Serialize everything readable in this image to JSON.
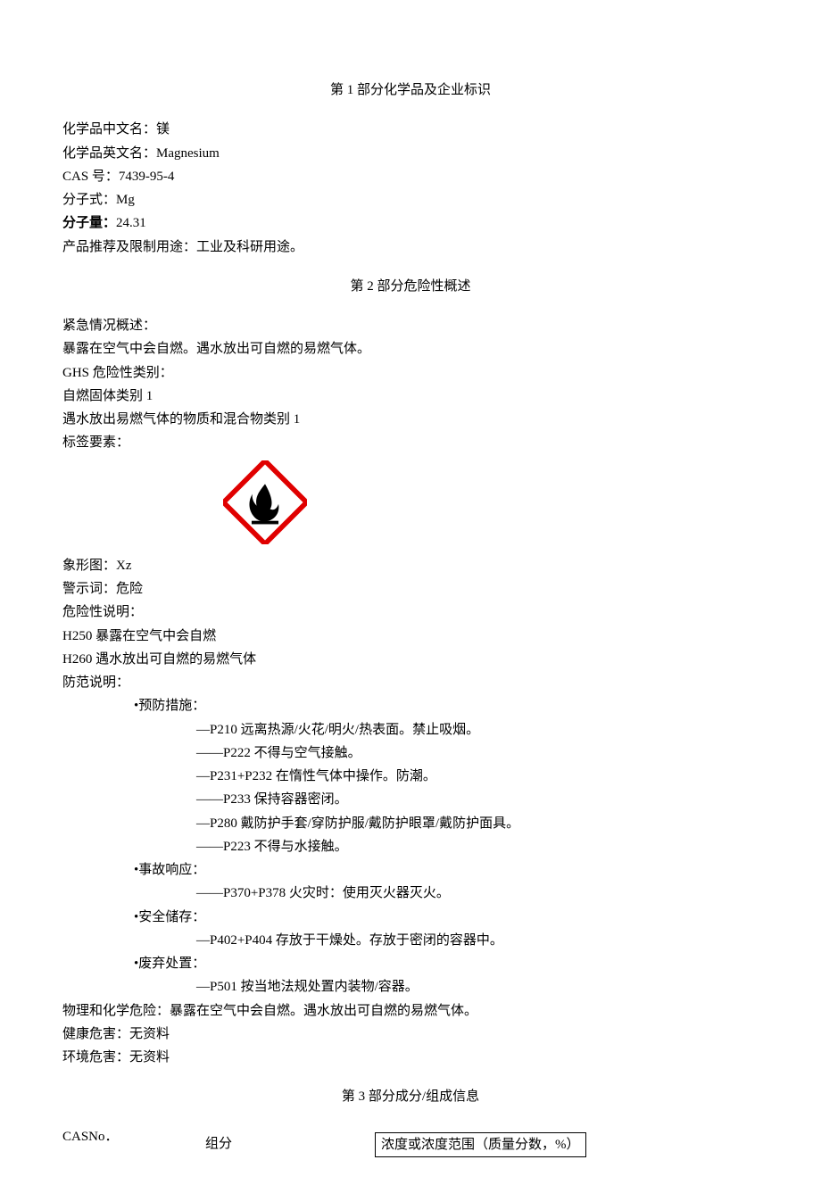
{
  "section1": {
    "title": "第 1 部分化学品及企业标识",
    "name_cn_label": "化学品中文名：镁",
    "name_en_label": "化学品英文名：Magnesium",
    "cas_label": "CAS 号：7439-95-4",
    "formula_label": "分子式：Mg",
    "mw_label_bold": "分子量：",
    "mw_value": "24.31",
    "usage_label": "产品推荐及限制用途：工业及科研用途。"
  },
  "section2": {
    "title": "第 2 部分危险性概述",
    "emergency_header": "紧急情况概述：",
    "emergency_text": "暴露在空气中会自燃。遇水放出可自燃的易燃气体。",
    "ghs_header": "GHS 危险性类别：",
    "ghs_cat1": "自燃固体类别 1",
    "ghs_cat2": "遇水放出易燃气体的物质和混合物类别 1",
    "label_elements": "标签要素：",
    "pictogram_label": "象形图：Xz",
    "pictogram_name": "GHS 火焰象形图",
    "signal_word": "警示词：危险",
    "hazard_header": "危险性说明：",
    "h250": "H250 暴露在空气中会自燃",
    "h260": "H260 遇水放出可自燃的易燃气体",
    "precaution_header": "防范说明：",
    "prevention_header": "•预防措施：",
    "p210": "—P210 远离热源/火花/明火/热表面。禁止吸烟。",
    "p222": "——P222 不得与空气接触。",
    "p231_232": "—P231+P232 在惰性气体中操作。防潮。",
    "p233": "——P233 保持容器密闭。",
    "p280": "—P280 戴防护手套/穿防护服/戴防护眼罩/戴防护面具。",
    "p223": "——P223 不得与水接触。",
    "response_header": "•事故响应：",
    "p370_378": "——P370+P378 火灾时：使用灭火器灭火。",
    "storage_header": "•安全储存：",
    "p402_404": "—P402+P404 存放于干燥处。存放于密闭的容器中。",
    "disposal_header": "•废弃处置：",
    "p501": "—P501 按当地法规处置内装物/容器。",
    "phys_chem": "物理和化学危险：暴露在空气中会自燃。遇水放出可自燃的易燃气体。",
    "health": "健康危害：无资料",
    "env": "环境危害：无资料"
  },
  "section3": {
    "title": "第 3 部分成分/组成信息",
    "casno_label": "CASNo．",
    "col_component": "组分",
    "col_concentration": "浓度或浓度范围（质量分数，%）"
  }
}
